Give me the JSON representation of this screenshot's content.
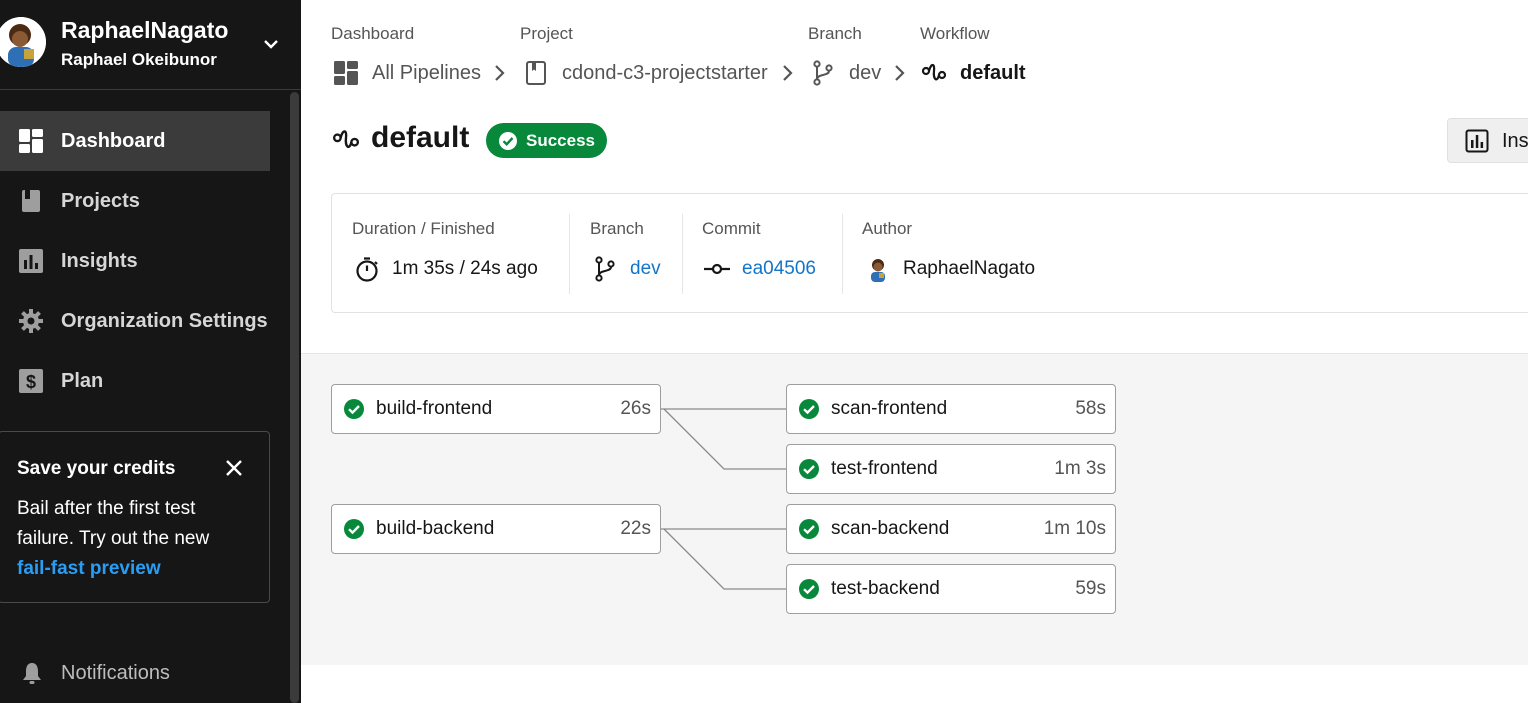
{
  "user": {
    "username": "RaphaelNagato",
    "full_name": "Raphael Okeibunor"
  },
  "sidebar": {
    "items": [
      {
        "label": "Dashboard",
        "icon": "dashboard-icon",
        "active": true
      },
      {
        "label": "Projects",
        "icon": "project-book-icon"
      },
      {
        "label": "Insights",
        "icon": "insights-chart-icon"
      },
      {
        "label": "Organization Settings",
        "icon": "gear-icon"
      },
      {
        "label": "Plan",
        "icon": "dollar-icon"
      }
    ],
    "credits_card": {
      "title": "Save your credits",
      "body": "Bail after the first test failure. Try out the new",
      "link": "fail-fast preview"
    },
    "notifications_label": "Notifications"
  },
  "breadcrumb": {
    "dashboard": {
      "label": "Dashboard",
      "value": "All Pipelines"
    },
    "project": {
      "label": "Project",
      "value": "cdond-c3-projectstarter"
    },
    "branch": {
      "label": "Branch",
      "value": "dev"
    },
    "workflow": {
      "label": "Workflow",
      "value": "default"
    }
  },
  "workflow": {
    "name": "default",
    "status": "Success",
    "insights_button": "Ins"
  },
  "summary": {
    "duration": {
      "label": "Duration / Finished",
      "value": "1m 35s / 24s ago"
    },
    "branch": {
      "label": "Branch",
      "value": "dev"
    },
    "commit": {
      "label": "Commit",
      "value": "ea04506"
    },
    "author": {
      "label": "Author",
      "value": "RaphaelNagato"
    }
  },
  "jobs": [
    {
      "name": "build-frontend",
      "duration": "26s",
      "status": "success"
    },
    {
      "name": "scan-frontend",
      "duration": "58s",
      "status": "success"
    },
    {
      "name": "test-frontend",
      "duration": "1m 3s",
      "status": "success"
    },
    {
      "name": "build-backend",
      "duration": "22s",
      "status": "success"
    },
    {
      "name": "scan-backend",
      "duration": "1m 10s",
      "status": "success"
    },
    {
      "name": "test-backend",
      "duration": "59s",
      "status": "success"
    }
  ],
  "colors": {
    "sidebar_bg": "#161616",
    "success_green": "#07883b",
    "link_blue": "#1375c9",
    "credits_link": "#2a9df4"
  }
}
